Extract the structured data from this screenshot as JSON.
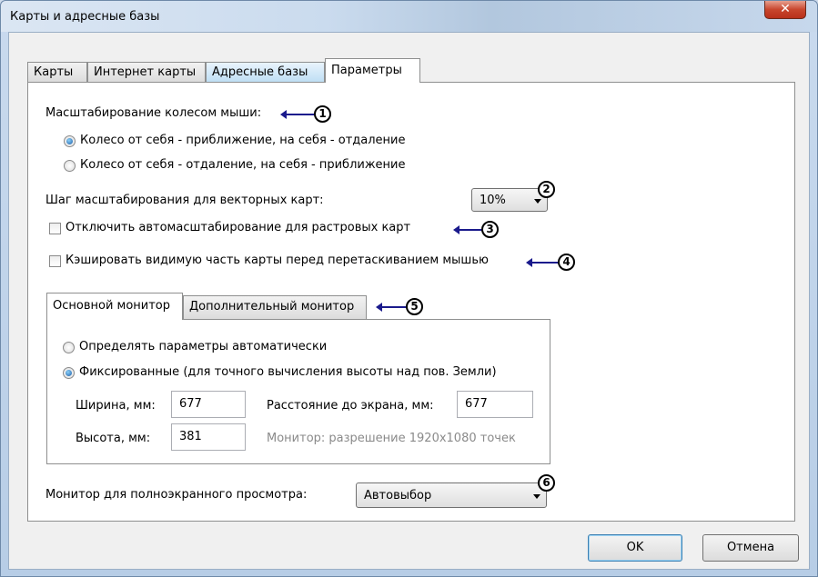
{
  "window": {
    "title": "Карты и адресные базы",
    "close_icon": "close-icon"
  },
  "tabs": [
    {
      "label": "Карты"
    },
    {
      "label": "Интернет карты"
    },
    {
      "label": "Адресные базы"
    },
    {
      "label": "Параметры"
    }
  ],
  "wheel_zoom": {
    "label": "Масштабирование колесом мыши:",
    "option1": "Колесо от себя - приближение, на себя - отдаление",
    "option2": "Колесо от себя - отдаление, на себя - приближение",
    "selected": 1
  },
  "vector_step": {
    "label": "Шаг масштабирования для векторных карт:",
    "value": "10%"
  },
  "disable_autoscale": {
    "label": "Отключить автомасштабирование для растровых карт",
    "checked": false
  },
  "cache_visible": {
    "label": "Кэшировать видимую часть карты перед перетаскиванием мышью",
    "checked": false
  },
  "monitor_tabs": [
    {
      "label": "Основной монитор"
    },
    {
      "label": "Дополнительный монитор"
    }
  ],
  "monitor": {
    "auto_label": "Определять параметры автоматически",
    "fixed_label": "Фиксированные (для точного вычисления высоты над пов. Земли)",
    "width_label": "Ширина, мм:",
    "width_value": "677",
    "height_label": "Высота, мм:",
    "height_value": "381",
    "distance_label": "Расстояние до экрана, мм:",
    "distance_value": "677",
    "info": "Монитор:  разрешение 1920x1080 точек"
  },
  "fullscreen": {
    "label": "Монитор для полноэкранного просмотра:",
    "value": "Автовыбор"
  },
  "annotations": [
    "1",
    "2",
    "3",
    "4",
    "5",
    "6"
  ],
  "buttons": {
    "ok": "OK",
    "cancel": "Отмена"
  }
}
